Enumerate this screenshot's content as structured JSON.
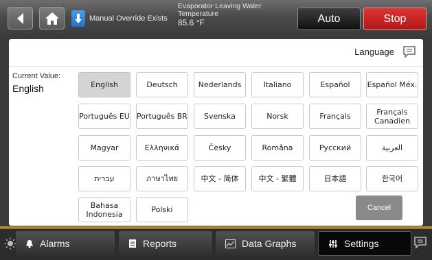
{
  "header": {
    "override_text": "Manual Override Exists",
    "sensor_label_line1": "Evaporator Leaving Water",
    "sensor_label_line2": "Temperature",
    "sensor_value": "85.6 °F",
    "auto_label": "Auto",
    "stop_label": "Stop",
    "icons": [
      "back-arrow-icon",
      "home-icon",
      "manual-override-icon"
    ]
  },
  "panel": {
    "title": "Language",
    "current_value_label": "Current Value:",
    "current_value": "English",
    "languages": [
      "English",
      "Deutsch",
      "Nederlands",
      "Italiano",
      "Español",
      "Español Méx.",
      "Português EU",
      "Português BR",
      "Svenska",
      "Norsk",
      "Français",
      "Français Canadien",
      "Magyar",
      "Ελληνικά",
      "Česky",
      "Româna",
      "Русский",
      "العربية",
      "עברית",
      "ภาษาไทย",
      "中文 - 简体",
      "中文 - 繁體",
      "日本語",
      "한국어",
      "Bahasa Indonesia",
      "Polski"
    ],
    "selected_language": "English",
    "cancel_label": "Cancel"
  },
  "footer": {
    "tabs": [
      {
        "label": "Alarms",
        "icon": "bell-icon"
      },
      {
        "label": "Reports",
        "icon": "report-icon"
      },
      {
        "label": "Data Graphs",
        "icon": "graph-icon"
      },
      {
        "label": "Settings",
        "icon": "settings-sliders-icon"
      }
    ],
    "active_tab": "Settings"
  },
  "colors": {
    "stop_red": "#c92222",
    "accent_gold": "#c9a245",
    "override_blue": "#2f86d6",
    "selected_gray": "#d4d4d4"
  }
}
